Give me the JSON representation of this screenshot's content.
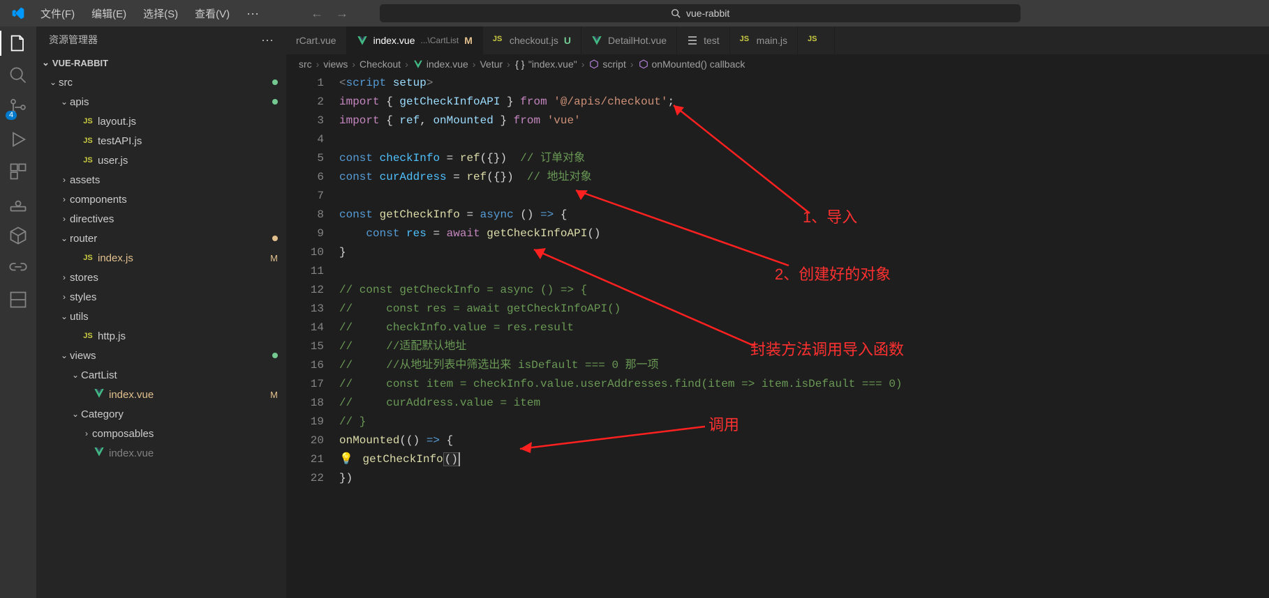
{
  "menu": {
    "file": "文件(F)",
    "edit": "编辑(E)",
    "select": "选择(S)",
    "view": "查看(V)",
    "more": "···"
  },
  "search": {
    "text": "vue-rabbit"
  },
  "sidebar": {
    "title": "资源管理器",
    "project": "VUE-RABBIT"
  },
  "activity": {
    "badge": "4"
  },
  "tree": [
    {
      "type": "folder",
      "label": "src",
      "depth": 1,
      "expanded": true,
      "status": "dot-u"
    },
    {
      "type": "folder",
      "label": "apis",
      "depth": 2,
      "expanded": true,
      "status": "dot-u"
    },
    {
      "type": "file",
      "label": "layout.js",
      "depth": 3,
      "icon": "js"
    },
    {
      "type": "file",
      "label": "testAPI.js",
      "depth": 3,
      "icon": "js"
    },
    {
      "type": "file",
      "label": "user.js",
      "depth": 3,
      "icon": "js"
    },
    {
      "type": "folder",
      "label": "assets",
      "depth": 2,
      "expanded": false
    },
    {
      "type": "folder",
      "label": "components",
      "depth": 2,
      "expanded": false
    },
    {
      "type": "folder",
      "label": "directives",
      "depth": 2,
      "expanded": false
    },
    {
      "type": "folder",
      "label": "router",
      "depth": 2,
      "expanded": true,
      "status": "dot-m"
    },
    {
      "type": "file",
      "label": "index.js",
      "depth": 3,
      "icon": "js",
      "statusLetter": "M",
      "cls": "modified"
    },
    {
      "type": "folder",
      "label": "stores",
      "depth": 2,
      "expanded": false
    },
    {
      "type": "folder",
      "label": "styles",
      "depth": 2,
      "expanded": false
    },
    {
      "type": "folder",
      "label": "utils",
      "depth": 2,
      "expanded": true
    },
    {
      "type": "file",
      "label": "http.js",
      "depth": 3,
      "icon": "js"
    },
    {
      "type": "folder",
      "label": "views",
      "depth": 2,
      "expanded": true,
      "status": "dot-u"
    },
    {
      "type": "folder",
      "label": "CartList",
      "depth": 3,
      "expanded": true
    },
    {
      "type": "file",
      "label": "index.vue",
      "depth": 4,
      "icon": "vue",
      "statusLetter": "M",
      "cls": "modified"
    },
    {
      "type": "folder",
      "label": "Category",
      "depth": 3,
      "expanded": true
    },
    {
      "type": "folder",
      "label": "composables",
      "depth": 4,
      "expanded": false
    },
    {
      "type": "file",
      "label": "index.vue",
      "depth": 4,
      "icon": "vue",
      "dim": true
    }
  ],
  "tabs": [
    {
      "label": "rCart.vue",
      "icon": "none",
      "partial": true
    },
    {
      "label": "index.vue",
      "suffix": "...\\CartList",
      "icon": "vue",
      "status": "M",
      "active": true
    },
    {
      "label": "checkout.js",
      "icon": "js",
      "status": "U"
    },
    {
      "label": "DetailHot.vue",
      "icon": "vue"
    },
    {
      "label": "test",
      "icon": "list"
    },
    {
      "label": "main.js",
      "icon": "js"
    },
    {
      "label": "",
      "icon": "js",
      "partial": true
    }
  ],
  "breadcrumbs": [
    {
      "text": "src"
    },
    {
      "text": "views"
    },
    {
      "text": "Checkout"
    },
    {
      "text": "index.vue",
      "icon": "vue"
    },
    {
      "text": "Vetur"
    },
    {
      "text": "\"index.vue\"",
      "icon": "braces"
    },
    {
      "text": "script",
      "icon": "cube"
    },
    {
      "text": "onMounted() callback",
      "icon": "cube"
    }
  ],
  "code": {
    "lines": [
      {
        "n": 1,
        "tokens": [
          [
            "tag",
            "<"
          ],
          [
            "kw",
            "script"
          ],
          [
            "pun",
            " "
          ],
          [
            "var",
            "setup"
          ],
          [
            "tag",
            ">"
          ]
        ]
      },
      {
        "n": 2,
        "tokens": [
          [
            "kw2",
            "import"
          ],
          [
            "pun",
            " { "
          ],
          [
            "var",
            "getCheckInfoAPI"
          ],
          [
            "pun",
            " } "
          ],
          [
            "kw2",
            "from"
          ],
          [
            "pun",
            " "
          ],
          [
            "str",
            "'@/apis/checkout'"
          ],
          [
            "pun",
            ";"
          ]
        ]
      },
      {
        "n": 3,
        "tokens": [
          [
            "kw2",
            "import"
          ],
          [
            "pun",
            " { "
          ],
          [
            "var",
            "ref"
          ],
          [
            "pun",
            ", "
          ],
          [
            "var",
            "onMounted"
          ],
          [
            "pun",
            " } "
          ],
          [
            "kw2",
            "from"
          ],
          [
            "pun",
            " "
          ],
          [
            "str",
            "'vue'"
          ]
        ]
      },
      {
        "n": 4,
        "tokens": []
      },
      {
        "n": 5,
        "tokens": [
          [
            "kw",
            "const"
          ],
          [
            "pun",
            " "
          ],
          [
            "const",
            "checkInfo"
          ],
          [
            "pun",
            " = "
          ],
          [
            "fn",
            "ref"
          ],
          [
            "pun",
            "({})  "
          ],
          [
            "com",
            "// 订单对象"
          ]
        ]
      },
      {
        "n": 6,
        "tokens": [
          [
            "kw",
            "const"
          ],
          [
            "pun",
            " "
          ],
          [
            "const",
            "curAddress"
          ],
          [
            "pun",
            " = "
          ],
          [
            "fn",
            "ref"
          ],
          [
            "pun",
            "({})  "
          ],
          [
            "com",
            "// 地址对象"
          ]
        ]
      },
      {
        "n": 7,
        "tokens": []
      },
      {
        "n": 8,
        "tokens": [
          [
            "kw",
            "const"
          ],
          [
            "pun",
            " "
          ],
          [
            "fn",
            "getCheckInfo"
          ],
          [
            "pun",
            " = "
          ],
          [
            "kw",
            "async"
          ],
          [
            "pun",
            " () "
          ],
          [
            "kw",
            "=>"
          ],
          [
            "pun",
            " {"
          ]
        ]
      },
      {
        "n": 9,
        "tokens": [
          [
            "pun",
            "    "
          ],
          [
            "kw",
            "const"
          ],
          [
            "pun",
            " "
          ],
          [
            "const",
            "res"
          ],
          [
            "pun",
            " = "
          ],
          [
            "kw2",
            "await"
          ],
          [
            "pun",
            " "
          ],
          [
            "fn",
            "getCheckInfoAPI"
          ],
          [
            "pun",
            "()"
          ]
        ]
      },
      {
        "n": 10,
        "tokens": [
          [
            "pun",
            "}"
          ]
        ]
      },
      {
        "n": 11,
        "tokens": []
      },
      {
        "n": 12,
        "tokens": [
          [
            "com",
            "// const getCheckInfo = async () => {"
          ]
        ]
      },
      {
        "n": 13,
        "tokens": [
          [
            "com",
            "//     const res = await getCheckInfoAPI()"
          ]
        ]
      },
      {
        "n": 14,
        "tokens": [
          [
            "com",
            "//     checkInfo.value = res.result"
          ]
        ]
      },
      {
        "n": 15,
        "tokens": [
          [
            "com",
            "//     //适配默认地址"
          ]
        ]
      },
      {
        "n": 16,
        "tokens": [
          [
            "com",
            "//     //从地址列表中筛选出来 isDefault === 0 那一项"
          ]
        ]
      },
      {
        "n": 17,
        "tokens": [
          [
            "com",
            "//     const item = checkInfo.value.userAddresses.find(item => item.isDefault === 0)"
          ]
        ]
      },
      {
        "n": 18,
        "tokens": [
          [
            "com",
            "//     curAddress.value = item"
          ]
        ]
      },
      {
        "n": 19,
        "tokens": [
          [
            "com",
            "// }"
          ]
        ]
      },
      {
        "n": 20,
        "tokens": [
          [
            "fn",
            "onMounted"
          ],
          [
            "pun",
            "(() "
          ],
          [
            "kw",
            "=>"
          ],
          [
            "pun",
            " {"
          ]
        ]
      },
      {
        "n": 21,
        "tokens": [],
        "special": "lightbulb"
      },
      {
        "n": 22,
        "tokens": [
          [
            "pun",
            "})"
          ]
        ]
      }
    ],
    "line21": {
      "fn": "getCheckInfo",
      "parens": "()"
    }
  },
  "annotations": {
    "a1": "1、导入",
    "a2": "2、创建好的对象",
    "a3": "封装方法调用导入函数",
    "a4": "调用"
  }
}
